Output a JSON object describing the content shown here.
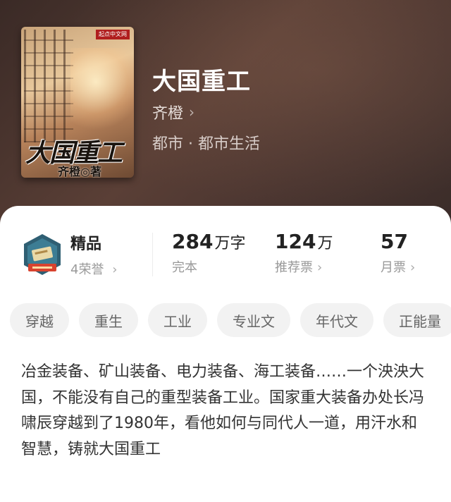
{
  "book": {
    "title": "大国重工",
    "author": "齐橙",
    "category": "都市 · 都市生活",
    "cover": {
      "publisher_label": "起点中文网",
      "title_text": "大国重工",
      "author_text": "齐橙◎著"
    }
  },
  "stats": {
    "badge_icon": "quality-badge-icon",
    "quality_label": "精品",
    "honors": "4荣誉",
    "word_count_value": "284",
    "word_count_unit": "万字",
    "status": "完本",
    "recommend_value": "124",
    "recommend_unit": "万",
    "recommend_label": "推荐票",
    "monthly_value": "57",
    "monthly_label": "月票"
  },
  "tags": [
    "穿越",
    "重生",
    "工业",
    "专业文",
    "年代文",
    "正能量"
  ],
  "description": "冶金装备、矿山装备、电力装备、海工装备……一个泱泱大国，不能没有自己的重型装备工业。国家重大装备办处长冯啸辰穿越到了1980年，看他如何与同代人一道，用汗水和智慧，铸就大国重工",
  "colors": {
    "header_bg": "#4a3530",
    "card_bg": "#ffffff",
    "tag_bg": "#f2f2f2"
  }
}
